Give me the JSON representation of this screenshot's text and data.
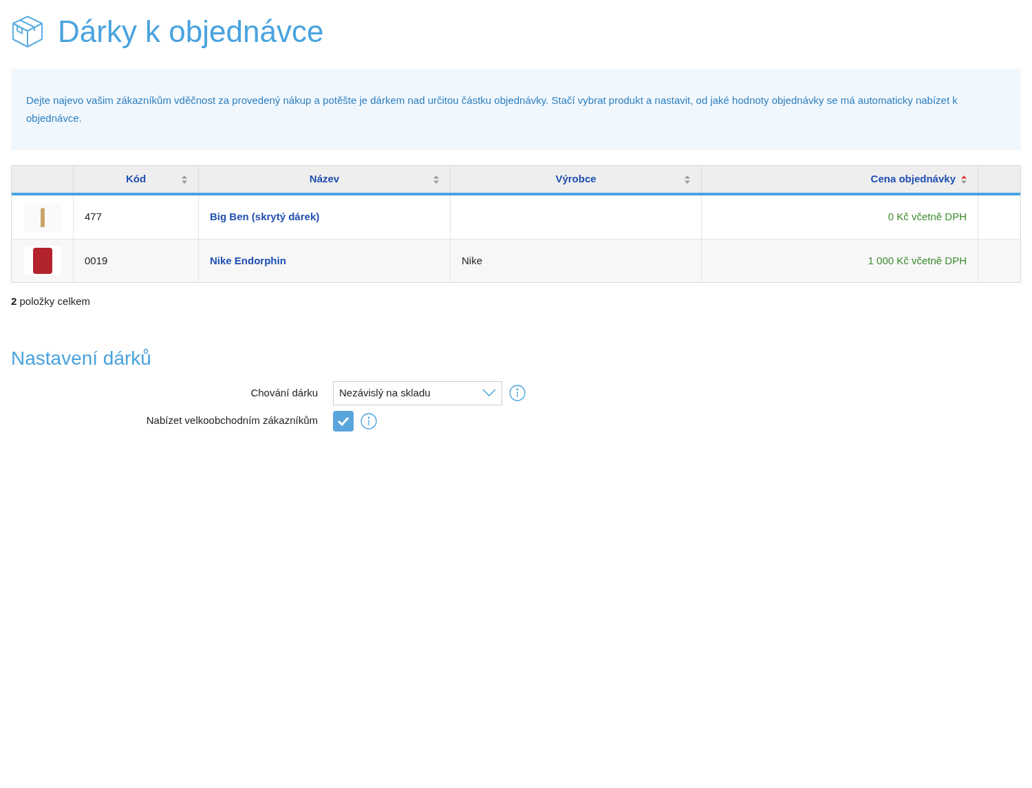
{
  "page_title": "Dárky k objednávce",
  "info": "Dejte najevo vašim zákazníkům vděčnost za provedený nákup a potěšte je dárkem nad určitou částku objednávky. Stačí vybrat produkt a nastavit, od jaké hodnoty objednávky se má automaticky nabízet k objednávce.",
  "table": {
    "columns": [
      {
        "label": "Kód",
        "sorted": false
      },
      {
        "label": "Název",
        "sorted": false
      },
      {
        "label": "Výrobce",
        "sorted": false
      },
      {
        "label": "Cena objednávky",
        "sorted": true
      }
    ],
    "rows": [
      {
        "code": "477",
        "name": "Big Ben (skrytý dárek)",
        "price": "0 Kč včetně DPH"
      },
      {
        "code": "0019",
        "name": "Nike Endorphin",
        "manufacturer": "Nike",
        "price": "1 000 Kč včetně DPH"
      }
    ]
  },
  "total": "**2** položky celkem",
  "settings": {
    "title": "Nastavení dárků",
    "fields": [
      {
        "kind": "select",
        "label": "Chování dárku",
        "value": "Nezávislý na skladu"
      },
      {
        "kind": "checkbox",
        "label": "Nabízet velkoobchodním zákazníkům",
        "checked": true
      }
    ]
  }
}
